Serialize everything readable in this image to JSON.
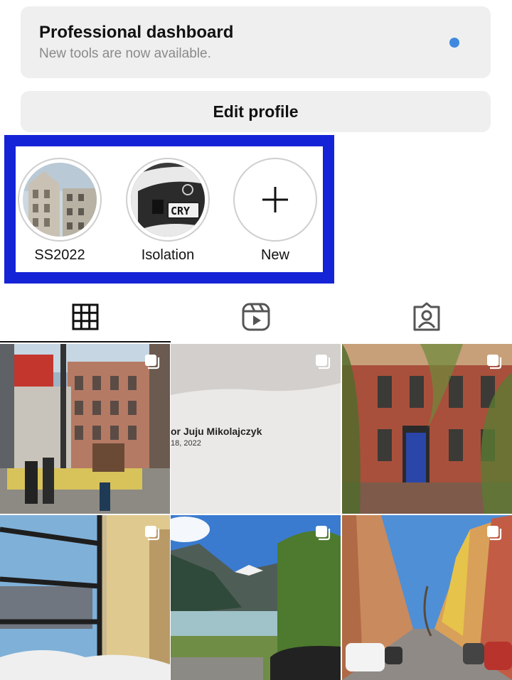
{
  "dashboard": {
    "title": "Professional dashboard",
    "subtitle": "New tools are now available.",
    "dot_color": "#3f8ae0"
  },
  "edit_profile": {
    "label": "Edit profile"
  },
  "highlights": [
    {
      "label": "SS2022",
      "thumb": "building-photo"
    },
    {
      "label": "Isolation",
      "thumb": "car-front-photo"
    },
    {
      "label": "New",
      "icon": "plus-icon"
    }
  ],
  "highlight_frame_color": "#1423d6",
  "tabs": [
    {
      "icon": "grid-icon",
      "selected": true
    },
    {
      "icon": "reels-icon",
      "selected": false
    },
    {
      "icon": "tagged-person-icon",
      "selected": false
    }
  ],
  "posts": [
    {
      "subject": "street with historic buildings",
      "multi": true
    },
    {
      "subject": "letter document",
      "multi": true,
      "text_line1": "or Juju Mikolajczyk",
      "text_line2": "18, 2022"
    },
    {
      "subject": "brick townhouse with blue door",
      "multi": true
    },
    {
      "subject": "view from window",
      "multi": true
    },
    {
      "subject": "mountain river landscape",
      "multi": true
    },
    {
      "subject": "colorful city street",
      "multi": true
    }
  ]
}
